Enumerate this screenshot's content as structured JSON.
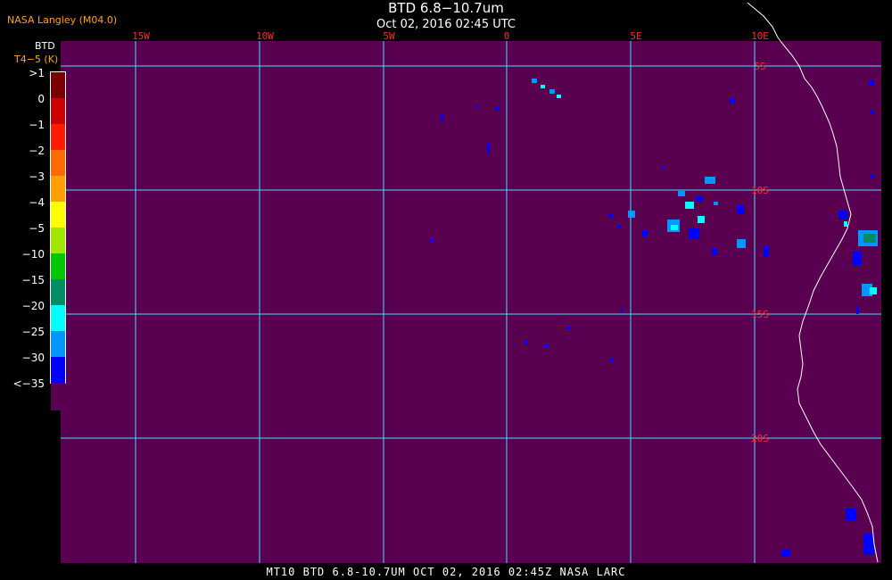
{
  "header": {
    "source": "NASA Langley (M04.0)",
    "product": "BTD 6.8−10.7um",
    "datetime": "Oct 02, 2016 02:45 UTC"
  },
  "legend": {
    "title": "BTD",
    "units": "T4−5 (K)",
    "ticks": [
      ">1",
      "0",
      "−1",
      "−2",
      "−3",
      "−4",
      "−5",
      "−10",
      "−15",
      "−20",
      "−25",
      "−30",
      "<−35"
    ],
    "colors": [
      "#7a0000",
      "#cc0000",
      "#ff1a00",
      "#ff6a00",
      "#ffa000",
      "#ffff00",
      "#a0e600",
      "#00c800",
      "#008c64",
      "#00ffff",
      "#0096ff",
      "#0000ff",
      "#5a0050"
    ]
  },
  "map": {
    "background_color": "#5a0050",
    "grid_color": "#40e0ff",
    "coast_color": "#ffffff",
    "longitudes": [
      "15W",
      "10W",
      "5W",
      "0",
      "5E",
      "10E"
    ],
    "latitudes": [
      "5S",
      "10S",
      "15S",
      "20S"
    ]
  },
  "footer": "MT10  BTD 6.8-10.7UM  OCT 02, 2016 02:45Z  NASA LARC"
}
